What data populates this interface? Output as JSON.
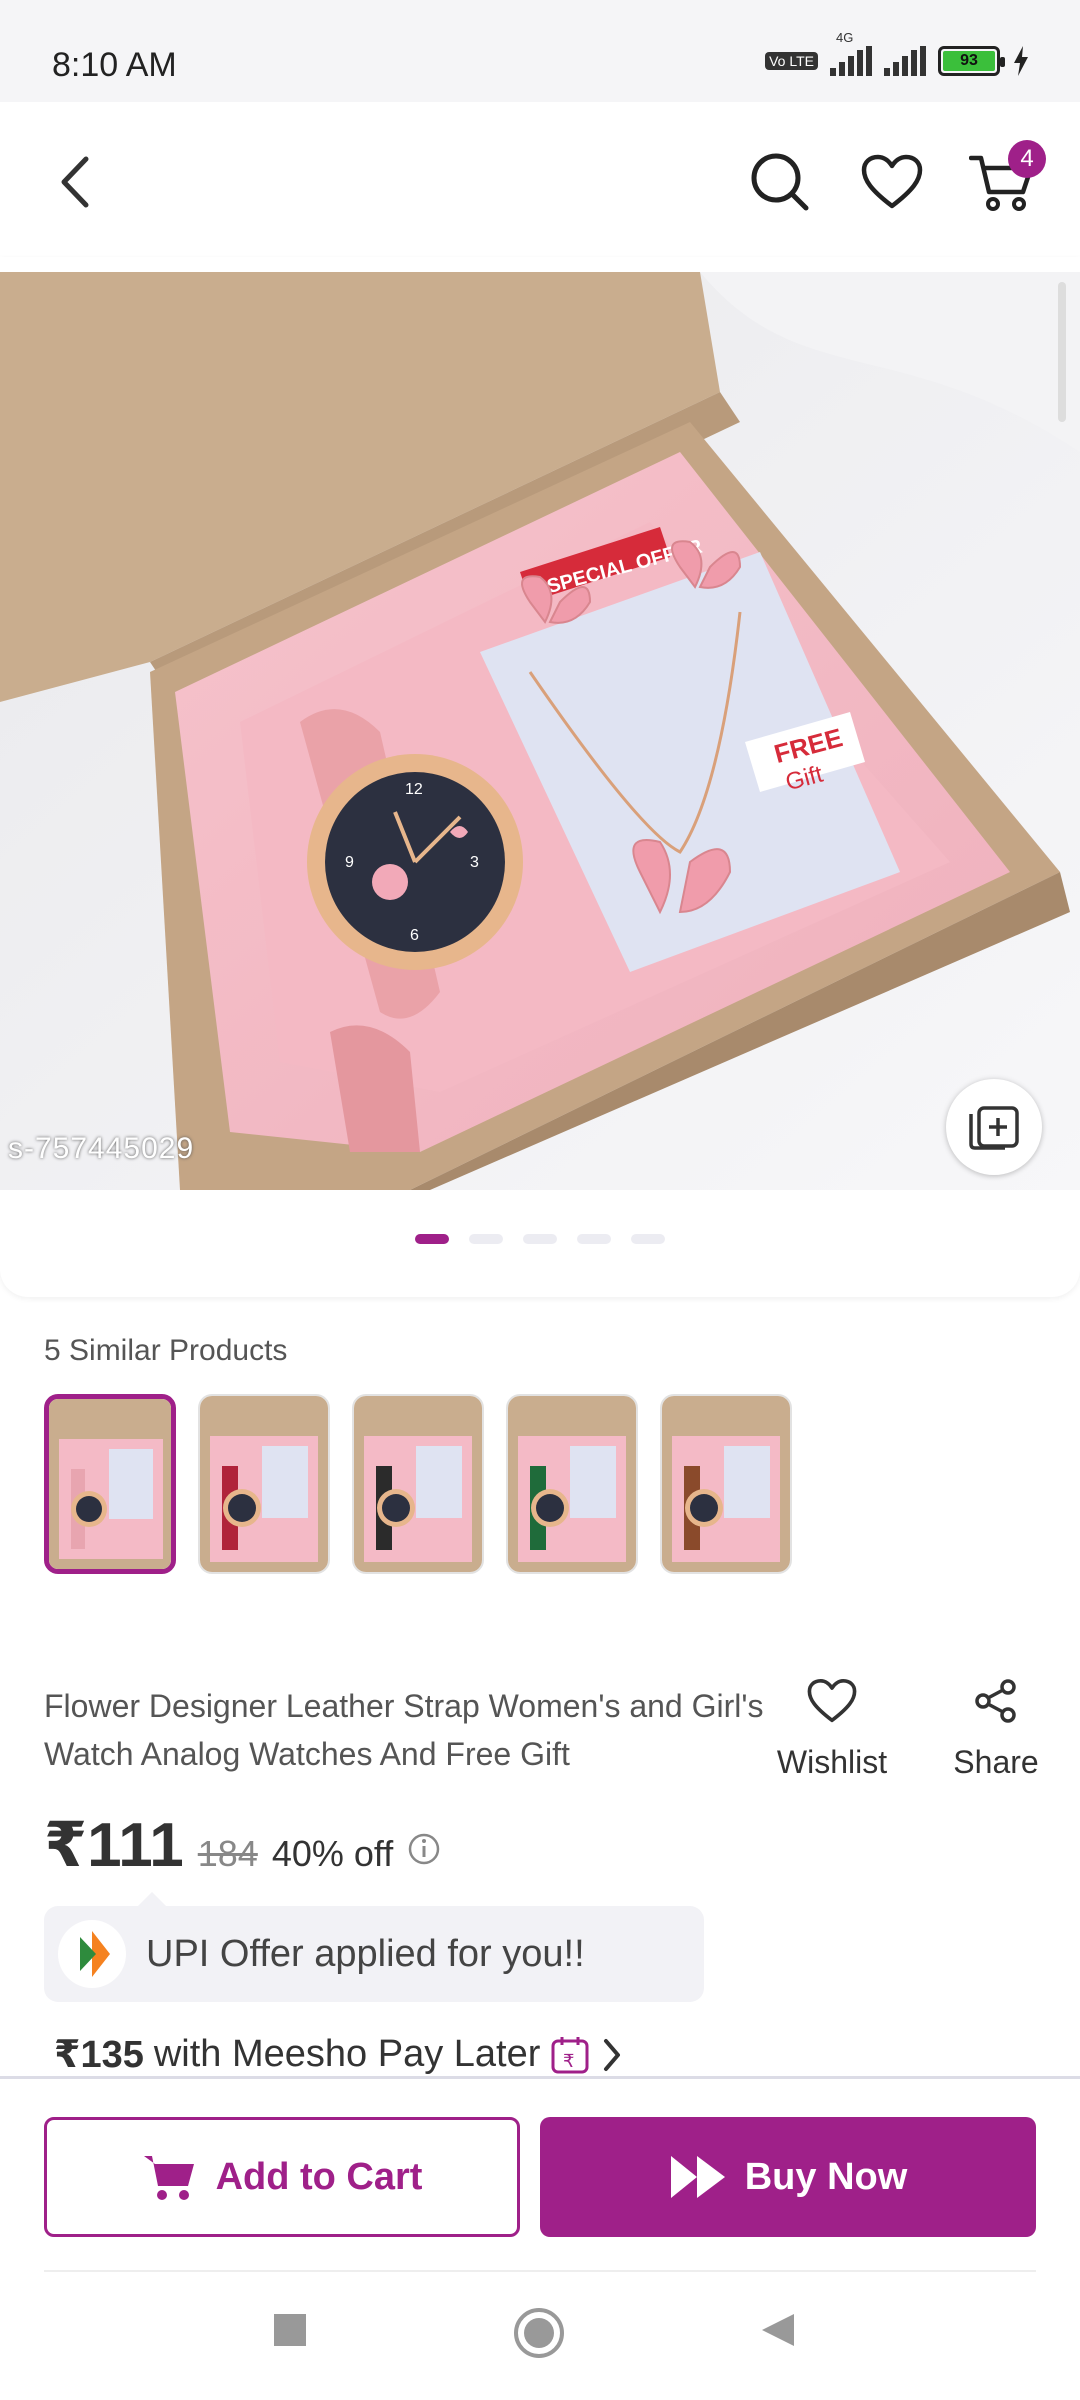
{
  "status_bar": {
    "time": "8:10 AM",
    "volte_label": "Vo LTE",
    "network_label": "4G",
    "battery_level": "93"
  },
  "header": {
    "cart_count": "4"
  },
  "gallery": {
    "sku_tag": "s-757445029",
    "image_count": 5,
    "active_index": 0,
    "box_labels": {
      "special_offer": "SPECIAL OFFER",
      "free_gift_1": "FREE",
      "free_gift_2": "Gift"
    }
  },
  "similar": {
    "title": "5 Similar Products",
    "strap_colors": [
      "#e8a5b0",
      "#b0233a",
      "#2b2b2b",
      "#1f6b3a",
      "#8a4a2b"
    ]
  },
  "product": {
    "title": "Flower Designer Leather Strap Women's and Girl's Watch Analog Watches And Free Gift",
    "price": "₹111",
    "mrp": "184",
    "discount": "40% off",
    "wishlist_label": "Wishlist",
    "share_label": "Share"
  },
  "offer": {
    "upi_text": "UPI Offer applied for you!!",
    "paylater_price": "₹135",
    "paylater_text": "with Meesho Pay Later"
  },
  "actions": {
    "add_to_cart": "Add to Cart",
    "buy_now": "Buy Now"
  },
  "colors": {
    "brand": "#9f2089"
  }
}
